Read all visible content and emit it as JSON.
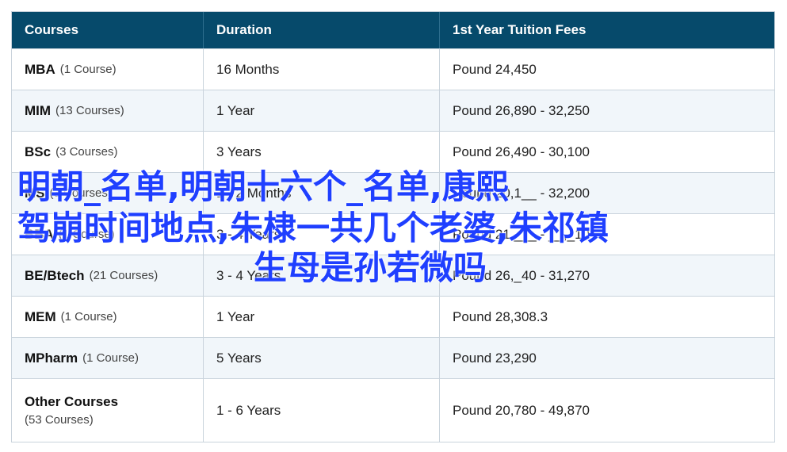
{
  "headers": [
    "Courses",
    "Duration",
    "1st Year Tuition Fees"
  ],
  "rows": [
    {
      "name": "MBA",
      "count": "(1 Course)",
      "duration": "16 Months",
      "fees": "Pound 24,450"
    },
    {
      "name": "MIM",
      "count": "(13 Courses)",
      "duration": "1 Year",
      "fees": "Pound 26,890 - 32,250"
    },
    {
      "name": "BSc",
      "count": "(3 Courses)",
      "duration": "3 Years",
      "fees": "Pound 26,490 - 30,100"
    },
    {
      "name": "MS",
      "count": "(3 Courses)",
      "duration": "1 - 2 Months",
      "fees": "Pound 20,1__ - 32,200"
    },
    {
      "name": "BBA",
      "count": "(1 Course)",
      "duration": "3 - 4 Years",
      "fees": "Pound 21,___ - __,_10"
    },
    {
      "name": "BE/Btech",
      "count": "(21 Courses)",
      "duration": "3 - 4 Years",
      "fees": "Pound 26,_40 - 31,270"
    },
    {
      "name": "MEM",
      "count": "(1 Course)",
      "duration": "1 Year",
      "fees": "Pound 28,308.3"
    },
    {
      "name": "MPharm",
      "count": "(1 Course)",
      "duration": "5 Years",
      "fees": "Pound 23,290"
    },
    {
      "name": "Other Courses",
      "count": "(53 Courses)",
      "duration": "1 - 6 Years",
      "fees": "Pound 20,780 - 49,870"
    }
  ],
  "overlay": {
    "line1": "明朝_名单,明朝十六个_名单,康熙",
    "line2": "驾崩时间地点,朱棣一共几个老婆,朱祁镇",
    "line3": "生母是孙若微吗"
  }
}
